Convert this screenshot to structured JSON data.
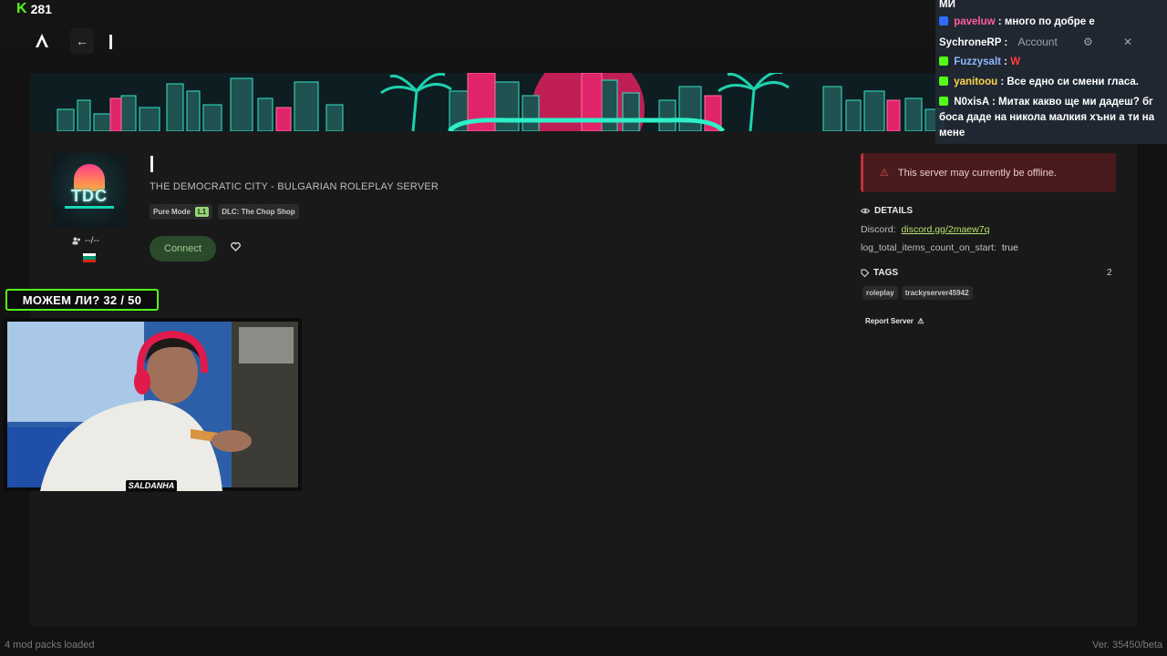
{
  "stream": {
    "viewer_count": "281",
    "viewer_icon": "kick-icon"
  },
  "nav": {
    "back_symbol": "←",
    "logo_icon": "fivem-logo-icon"
  },
  "server": {
    "logo_text": "TDC",
    "title": "THE DEMOCRATIC CITY - BULGARIAN ROLEPLAY SERVER",
    "players": "--/--",
    "flag_colors": [
      "#ffffff",
      "#00966e",
      "#d62612"
    ],
    "chips": {
      "mode": "Pure Mode",
      "mode_level": "L1",
      "dlc": "DLC: The Chop Shop"
    },
    "connect_label": "Connect"
  },
  "status": {
    "offline_text": "This server may currently be offline."
  },
  "details": {
    "heading": "DETAILS",
    "discord_label": "Discord:",
    "discord_value": "discord.gg/2maew7q",
    "log_label": "log_total_items_count_on_start:",
    "log_value": "true"
  },
  "tags": {
    "heading": "TAGS",
    "count": "2",
    "items": [
      "roleplay",
      "trackyserver45942"
    ]
  },
  "report_label": "Report Server",
  "chat": {
    "top_partial": "МИ",
    "messages": [
      {
        "user": "paveluw",
        "text": ": много по добре е",
        "user_color": "#ff5da2",
        "badge": "#2f6bff"
      },
      {
        "user": "SychroneRP",
        "text": ":",
        "user_color": "#ffffff",
        "badge": ""
      },
      {
        "user": "Fuzzysalt",
        "text": ":",
        "emote": "W",
        "user_color": "#8fb6ff",
        "badge": "#53fc18"
      },
      {
        "user": "yanitoou",
        "text": ": Все едно си смени гласа.",
        "user_color": "#ffd34e",
        "badge": "#53fc18"
      },
      {
        "user": "N0xisA",
        "text": ": Митак какво ще ми дадеш? бг боса даде на никола малкия хъни а ти на мене",
        "user_color": "#ffffff",
        "badge": "#53fc18"
      }
    ],
    "account_label": "Account"
  },
  "goal": {
    "text": "МОЖЕМ ЛИ? 32 / 50"
  },
  "cam": {
    "name": "SALDANHA"
  },
  "footer": {
    "mods": "4 mod packs loaded",
    "version": "Ver. 35450/beta"
  }
}
